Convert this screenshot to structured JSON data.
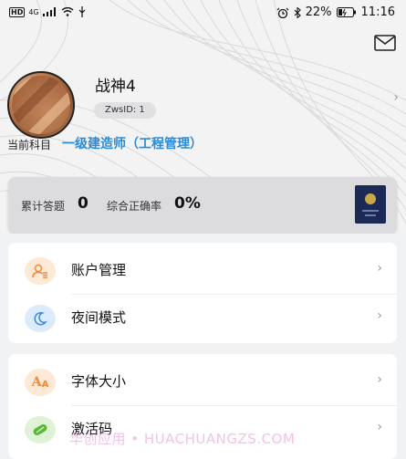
{
  "status_bar": {
    "left": {
      "hd": "HD",
      "network": "4G"
    },
    "right": {
      "battery_percent": "22%",
      "time": "11:16"
    }
  },
  "profile": {
    "username": "战神4",
    "zws_id": "ZwsID: 1",
    "subject_label": "当前科目",
    "subject_value": "一级建造师（工程管理）"
  },
  "stats": {
    "answered_label": "累计答题",
    "answered_value": "0",
    "accuracy_label": "综合正确率",
    "accuracy_value": "0%"
  },
  "menu_group_1": [
    {
      "label": "账户管理",
      "icon": "user-list-icon",
      "icon_bg": "#fde9d6",
      "icon_color": "#f08a3a"
    },
    {
      "label": "夜间模式",
      "icon": "moon-icon",
      "icon_bg": "#dcebfb",
      "icon_color": "#3b8be0"
    }
  ],
  "menu_group_2": [
    {
      "label": "字体大小",
      "icon": "font-size-icon",
      "icon_bg": "#fde9d6",
      "icon_color": "#f08a3a"
    },
    {
      "label": "激活码",
      "icon": "key-icon",
      "icon_bg": "#dff2d6",
      "icon_color": "#5cb83a"
    }
  ],
  "watermark": "华创应用 • HUACHUANGZS.COM",
  "colors": {
    "accent_blue": "#2a8bd8",
    "page_bg": "#f1f2f4"
  }
}
